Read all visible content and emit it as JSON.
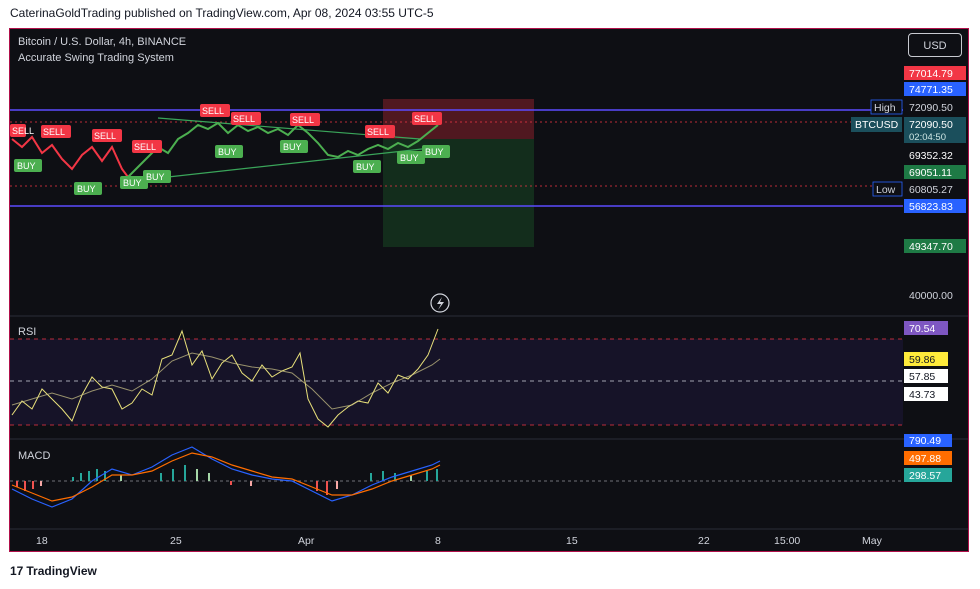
{
  "publisher": "CaterinaGoldTrading published on TradingView.com, Apr 08, 2024 03:55 UTC-5",
  "brand": "TradingView",
  "symbol_title": "Bitcoin / U.S. Dollar, 4h, BINANCE",
  "indicator_name": "Accurate Swing Trading System",
  "currency_button": "USD",
  "price_labels": {
    "p77014": "77014.79",
    "p74771": "74771.35",
    "high_tag": "High",
    "high_val": "72090.50",
    "sym_tag": "BTCUSD",
    "sym_val": "72090.50",
    "sym_sub": "02:04:50",
    "p69352": "69352.32",
    "p69051": "69051.11",
    "low_tag": "Low",
    "low_val": "60805.27",
    "p56823": "56823.83",
    "p49347": "49347.70",
    "p40000": "40000.00"
  },
  "signals": {
    "sell": "SELL",
    "buy": "BUY"
  },
  "rsi": {
    "label": "RSI",
    "v1": "70.54",
    "v2": "59.86",
    "v3": "57.85",
    "v4": "43.73"
  },
  "macd": {
    "label": "MACD",
    "v1": "790.49",
    "v2": "497.88",
    "v3": "298.57"
  },
  "time_axis": [
    "18",
    "25",
    "Apr",
    "8",
    "15",
    "22",
    "15:00",
    "May"
  ],
  "colors": {
    "buy": "#4caf50",
    "sell": "#f23645",
    "level_line": "#5b4bff",
    "rsi_line": "#e8e07a",
    "macd_up": "#26a69a",
    "macd_down": "#ef5350"
  }
}
